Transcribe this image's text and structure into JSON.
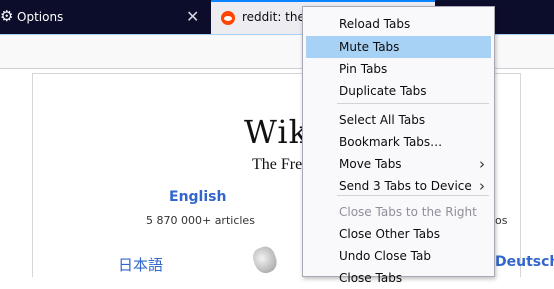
{
  "tabs": [
    {
      "title": "Options",
      "icon": "gear-icon",
      "close": "✕"
    },
    {
      "title": "reddit: the f",
      "icon": "reddit-icon"
    }
  ],
  "page": {
    "wordmark": "Wik",
    "tagline": "The Fre",
    "lang_en": "English",
    "count_en": "5 870 000+ articles",
    "lang_ja": "日本語",
    "lang_de": "Deutsch",
    "count_partial": "los"
  },
  "context_menu": {
    "items": [
      {
        "label": "Reload Tabs",
        "accel": "R"
      },
      {
        "label": "Mute Tabs",
        "accel": "M",
        "highlighted": true
      },
      {
        "label": "Pin Tabs",
        "accel": "P"
      },
      {
        "label": "Duplicate Tabs",
        "accel": "D"
      },
      {
        "label": "Select All Tabs",
        "accel": "S"
      },
      {
        "label": "Bookmark Tabs…",
        "accel": "B"
      },
      {
        "label": "Move Tabs",
        "accel": "v",
        "submenu": true
      },
      {
        "label": "Send 3 Tabs to Device",
        "accel": "n",
        "submenu": true
      },
      {
        "label": "Close Tabs to the Right",
        "disabled": true
      },
      {
        "label": "Close Other Tabs",
        "accel": "l"
      },
      {
        "label": "Undo Close Tab",
        "accel": "U"
      },
      {
        "label": "Close Tabs",
        "accel": "C"
      }
    ]
  },
  "colors": {
    "tabstrip": "#0c0c2b",
    "highlight": "#a8d2f5",
    "link": "#3366cc"
  }
}
